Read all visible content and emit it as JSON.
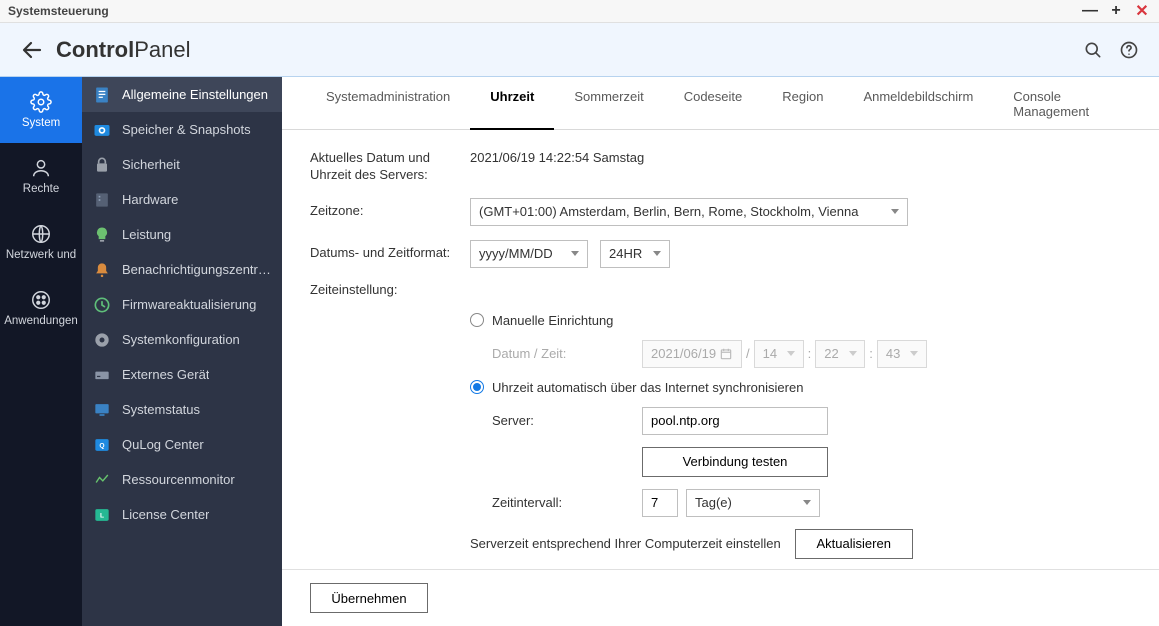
{
  "titlebar": {
    "title": "Systemsteuerung"
  },
  "header": {
    "bold": "Control",
    "thin": "Panel"
  },
  "categories": [
    {
      "label": "System"
    },
    {
      "label": "Rechte"
    },
    {
      "label": "Netzwerk und"
    },
    {
      "label": "Anwendungen"
    }
  ],
  "sidebar": {
    "items": [
      {
        "label": "Allgemeine Einstellungen"
      },
      {
        "label": "Speicher & Snapshots"
      },
      {
        "label": "Sicherheit"
      },
      {
        "label": "Hardware"
      },
      {
        "label": "Leistung"
      },
      {
        "label": "Benachrichtigungszentrum"
      },
      {
        "label": "Firmwareaktualisierung"
      },
      {
        "label": "Systemkonfiguration"
      },
      {
        "label": "Externes Gerät"
      },
      {
        "label": "Systemstatus"
      },
      {
        "label": "QuLog Center"
      },
      {
        "label": "Ressourcenmonitor"
      },
      {
        "label": "License Center"
      }
    ]
  },
  "tabs": {
    "items": [
      {
        "label": "Systemadministration"
      },
      {
        "label": "Uhrzeit"
      },
      {
        "label": "Sommerzeit"
      },
      {
        "label": "Codeseite"
      },
      {
        "label": "Region"
      },
      {
        "label": "Anmeldebildschirm"
      },
      {
        "label": "Console Management"
      }
    ]
  },
  "form": {
    "current_datetime_label": "Aktuelles Datum und Uhrzeit des Servers:",
    "current_datetime_value": "2021/06/19 14:22:54 Samstag",
    "timezone_label": "Zeitzone:",
    "timezone_value": "(GMT+01:00) Amsterdam, Berlin, Bern, Rome, Stockholm, Vienna",
    "datetimeformat_label": "Datums- und Zeitformat:",
    "dateformat_value": "yyyy/MM/DD",
    "timeformat_value": "24HR",
    "timesettings_label": "Zeiteinstellung:",
    "manual_label": "Manuelle Einrichtung",
    "manual_sub_label": "Datum / Zeit:",
    "manual_date": "2021/06/19",
    "manual_hour": "14",
    "manual_min": "22",
    "manual_sec": "43",
    "auto_label": "Uhrzeit automatisch über das Internet synchronisieren",
    "server_label": "Server:",
    "server_value": "pool.ntp.org",
    "test_button": "Verbindung testen",
    "interval_label": "Zeitintervall:",
    "interval_value": "7",
    "interval_unit": "Tag(e)",
    "sync_desc": "Serverzeit entsprechend Ihrer Computerzeit einstellen",
    "update_button": "Aktualisieren",
    "apply_button": "Übernehmen"
  }
}
